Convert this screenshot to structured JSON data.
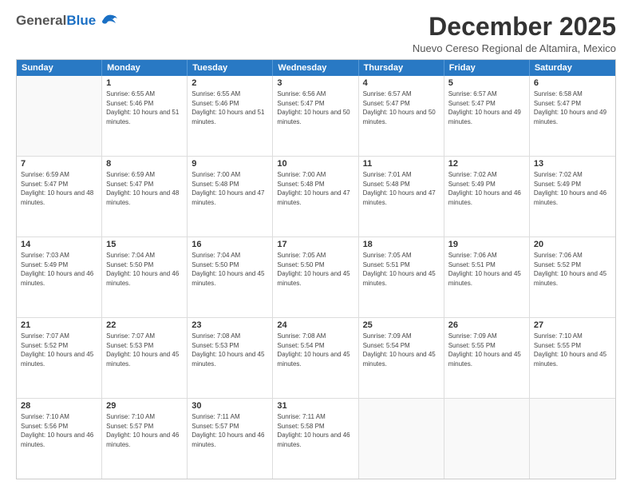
{
  "header": {
    "logo": {
      "general": "General",
      "blue": "Blue"
    },
    "title": "December 2025",
    "subtitle": "Nuevo Cereso Regional de Altamira, Mexico"
  },
  "calendar": {
    "days_of_week": [
      "Sunday",
      "Monday",
      "Tuesday",
      "Wednesday",
      "Thursday",
      "Friday",
      "Saturday"
    ],
    "weeks": [
      [
        {
          "day": "",
          "empty": true
        },
        {
          "day": "1",
          "sunrise": "6:55 AM",
          "sunset": "5:46 PM",
          "daylight": "10 hours and 51 minutes."
        },
        {
          "day": "2",
          "sunrise": "6:55 AM",
          "sunset": "5:46 PM",
          "daylight": "10 hours and 51 minutes."
        },
        {
          "day": "3",
          "sunrise": "6:56 AM",
          "sunset": "5:47 PM",
          "daylight": "10 hours and 50 minutes."
        },
        {
          "day": "4",
          "sunrise": "6:57 AM",
          "sunset": "5:47 PM",
          "daylight": "10 hours and 50 minutes."
        },
        {
          "day": "5",
          "sunrise": "6:57 AM",
          "sunset": "5:47 PM",
          "daylight": "10 hours and 49 minutes."
        },
        {
          "day": "6",
          "sunrise": "6:58 AM",
          "sunset": "5:47 PM",
          "daylight": "10 hours and 49 minutes."
        }
      ],
      [
        {
          "day": "7",
          "sunrise": "6:59 AM",
          "sunset": "5:47 PM",
          "daylight": "10 hours and 48 minutes."
        },
        {
          "day": "8",
          "sunrise": "6:59 AM",
          "sunset": "5:47 PM",
          "daylight": "10 hours and 48 minutes."
        },
        {
          "day": "9",
          "sunrise": "7:00 AM",
          "sunset": "5:48 PM",
          "daylight": "10 hours and 47 minutes."
        },
        {
          "day": "10",
          "sunrise": "7:00 AM",
          "sunset": "5:48 PM",
          "daylight": "10 hours and 47 minutes."
        },
        {
          "day": "11",
          "sunrise": "7:01 AM",
          "sunset": "5:48 PM",
          "daylight": "10 hours and 47 minutes."
        },
        {
          "day": "12",
          "sunrise": "7:02 AM",
          "sunset": "5:49 PM",
          "daylight": "10 hours and 46 minutes."
        },
        {
          "day": "13",
          "sunrise": "7:02 AM",
          "sunset": "5:49 PM",
          "daylight": "10 hours and 46 minutes."
        }
      ],
      [
        {
          "day": "14",
          "sunrise": "7:03 AM",
          "sunset": "5:49 PM",
          "daylight": "10 hours and 46 minutes."
        },
        {
          "day": "15",
          "sunrise": "7:04 AM",
          "sunset": "5:50 PM",
          "daylight": "10 hours and 46 minutes."
        },
        {
          "day": "16",
          "sunrise": "7:04 AM",
          "sunset": "5:50 PM",
          "daylight": "10 hours and 45 minutes."
        },
        {
          "day": "17",
          "sunrise": "7:05 AM",
          "sunset": "5:50 PM",
          "daylight": "10 hours and 45 minutes."
        },
        {
          "day": "18",
          "sunrise": "7:05 AM",
          "sunset": "5:51 PM",
          "daylight": "10 hours and 45 minutes."
        },
        {
          "day": "19",
          "sunrise": "7:06 AM",
          "sunset": "5:51 PM",
          "daylight": "10 hours and 45 minutes."
        },
        {
          "day": "20",
          "sunrise": "7:06 AM",
          "sunset": "5:52 PM",
          "daylight": "10 hours and 45 minutes."
        }
      ],
      [
        {
          "day": "21",
          "sunrise": "7:07 AM",
          "sunset": "5:52 PM",
          "daylight": "10 hours and 45 minutes."
        },
        {
          "day": "22",
          "sunrise": "7:07 AM",
          "sunset": "5:53 PM",
          "daylight": "10 hours and 45 minutes."
        },
        {
          "day": "23",
          "sunrise": "7:08 AM",
          "sunset": "5:53 PM",
          "daylight": "10 hours and 45 minutes."
        },
        {
          "day": "24",
          "sunrise": "7:08 AM",
          "sunset": "5:54 PM",
          "daylight": "10 hours and 45 minutes."
        },
        {
          "day": "25",
          "sunrise": "7:09 AM",
          "sunset": "5:54 PM",
          "daylight": "10 hours and 45 minutes."
        },
        {
          "day": "26",
          "sunrise": "7:09 AM",
          "sunset": "5:55 PM",
          "daylight": "10 hours and 45 minutes."
        },
        {
          "day": "27",
          "sunrise": "7:10 AM",
          "sunset": "5:55 PM",
          "daylight": "10 hours and 45 minutes."
        }
      ],
      [
        {
          "day": "28",
          "sunrise": "7:10 AM",
          "sunset": "5:56 PM",
          "daylight": "10 hours and 46 minutes."
        },
        {
          "day": "29",
          "sunrise": "7:10 AM",
          "sunset": "5:57 PM",
          "daylight": "10 hours and 46 minutes."
        },
        {
          "day": "30",
          "sunrise": "7:11 AM",
          "sunset": "5:57 PM",
          "daylight": "10 hours and 46 minutes."
        },
        {
          "day": "31",
          "sunrise": "7:11 AM",
          "sunset": "5:58 PM",
          "daylight": "10 hours and 46 minutes."
        },
        {
          "day": "",
          "empty": true
        },
        {
          "day": "",
          "empty": true
        },
        {
          "day": "",
          "empty": true
        }
      ]
    ]
  }
}
